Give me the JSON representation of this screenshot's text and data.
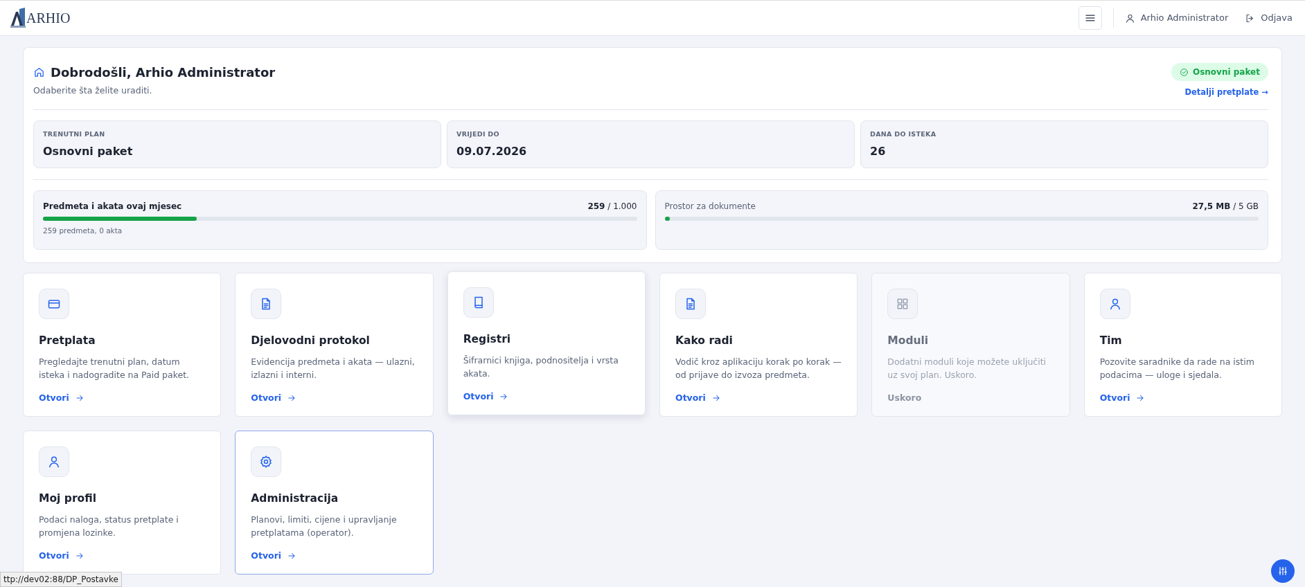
{
  "navbar": {
    "logo_text": "ARHIO",
    "user": "Arhio Administrator",
    "logout": "Odjava"
  },
  "welcome": {
    "title": "Dobrodošli, Arhio Administrator",
    "subtitle": "Odaberite šta želite uraditi.",
    "plan_badge": "Osnovni paket",
    "details_link": "Detalji pretplate →",
    "stats": [
      {
        "label": "TRENUTNI PLAN",
        "value": "Osnovni paket"
      },
      {
        "label": "VRIJEDI DO",
        "value": "09.07.2026"
      },
      {
        "label": "DANA DO ISTEKA",
        "value": "26"
      }
    ],
    "usage": [
      {
        "kind": "count",
        "label": "Predmeta i akata ovaj mjesec",
        "used": "259",
        "limit": "/ 1.000",
        "level": 0.259,
        "note": "259 predmeta, 0 akta"
      },
      {
        "kind": "storage",
        "label": "Prostor za dokumente",
        "used": "27,5 MB",
        "limit": "/ 5 GB",
        "level": 0.005
      }
    ]
  },
  "tiles": [
    {
      "title": "Pretplata",
      "text": "Pregledajte trenutni plan, datum isteka i nadogradite na Paid paket.",
      "action": "Otvori",
      "disabled": false,
      "raised": false,
      "highlighted": false
    },
    {
      "title": "Djelovodni protokol",
      "text": "Evidencija predmeta i akata — ulazni, izlazni i interni.",
      "action": "Otvori",
      "disabled": false,
      "raised": false,
      "highlighted": false
    },
    {
      "title": "Registri",
      "text": "Šifrarnici knjiga, podnositelja i vrsta akata.",
      "action": "Otvori",
      "disabled": false,
      "raised": true,
      "highlighted": false
    },
    {
      "title": "Kako radi",
      "text": "Vodič kroz aplikaciju korak po korak — od prijave do izvoza predmeta.",
      "action": "Otvori",
      "disabled": false,
      "raised": false,
      "highlighted": false
    },
    {
      "title": "Moduli",
      "text": "Dodatni moduli koje možete uključiti uz svoj plan. Uskoro.",
      "action": "Uskoro",
      "disabled": true,
      "raised": false,
      "highlighted": false
    },
    {
      "title": "Tim",
      "text": "Pozovite saradnike da rade na istim podacima — uloge i sjedala.",
      "action": "Otvori",
      "disabled": false,
      "raised": false,
      "highlighted": false
    },
    {
      "title": "Moj profil",
      "text": "Podaci naloga, status pretplate i promjena lozinke.",
      "action": "Otvori",
      "disabled": false,
      "raised": false,
      "highlighted": false
    },
    {
      "title": "Administracija",
      "text": "Planovi, limiti, cijene i upravljanje pretplatama (operator).",
      "action": "Otvori",
      "disabled": false,
      "raised": false,
      "highlighted": true
    }
  ],
  "status_bar": {
    "url": "ttp://dev02:88/DP_Postavke"
  }
}
